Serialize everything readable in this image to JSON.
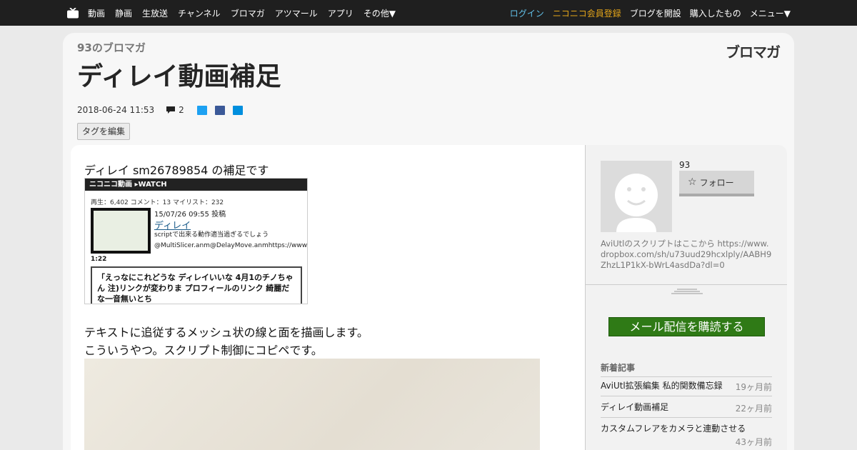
{
  "nav": {
    "left": [
      "動画",
      "静画",
      "生放送",
      "チャンネル",
      "ブロマガ",
      "アツマール",
      "アプリ",
      "その他▼"
    ],
    "login": "ログイン",
    "register": "ニコニコ会員登録",
    "open_blog": "ブログを開設",
    "purchased": "購入したもの",
    "menu": "メニュー▼",
    "colors": {
      "login": "#62c0e8",
      "register": "#e3a41a"
    }
  },
  "blog": {
    "name": "93のブロマガ",
    "logo": "ブロマガ"
  },
  "article": {
    "title": "ディレイ動画補足",
    "date": "2018-06-24 11:53",
    "comments": "2",
    "edit_tags": "タグを編集",
    "intro": "ディレイ sm26789854 の補足です",
    "para1": "テキストに追従するメッシュ状の線と面を描画します。",
    "para2": "こういうやつ。スクリプト制御にコピペです。"
  },
  "embed": {
    "header": "ニコニコ動画 ▸WATCH",
    "stats": "再生：6,402 コメント：13 マイリスト：232",
    "date": "15/07/26 09:55 投稿",
    "title": "ディレイ",
    "desc1": "scriptで出来る動作適当過ぎるでしょう",
    "desc2": "@MultiSlicer.anm@DelayMove.anmhttps://www.",
    "duration": "1:22",
    "comments": "「えっなにこれどうな ディレイいいな 4月1のチノちゃん 注)リンクが変わりま プロフィールのリンク 綺麗だな一音無いとち"
  },
  "sidebar": {
    "user": "93",
    "follow": "フォロー",
    "bio": "AviUtlのスクリプトはここから https://www.dropbox.com/sh/u73uud29hcxlply/AABH9ZhzL1P1kX-bWrL4asdDa?dl=0",
    "subscribe": "メール配信を購読する",
    "new_heading": "新着記事",
    "new_items": [
      {
        "title": "AviUtl拡張編集 私的関数備忘録",
        "ago": "19ヶ月前"
      },
      {
        "title": "ディレイ動画補足",
        "ago": "22ヶ月前"
      },
      {
        "title": "カスタムフレアをカメラと連動させる",
        "ago": "43ヶ月前"
      }
    ]
  }
}
